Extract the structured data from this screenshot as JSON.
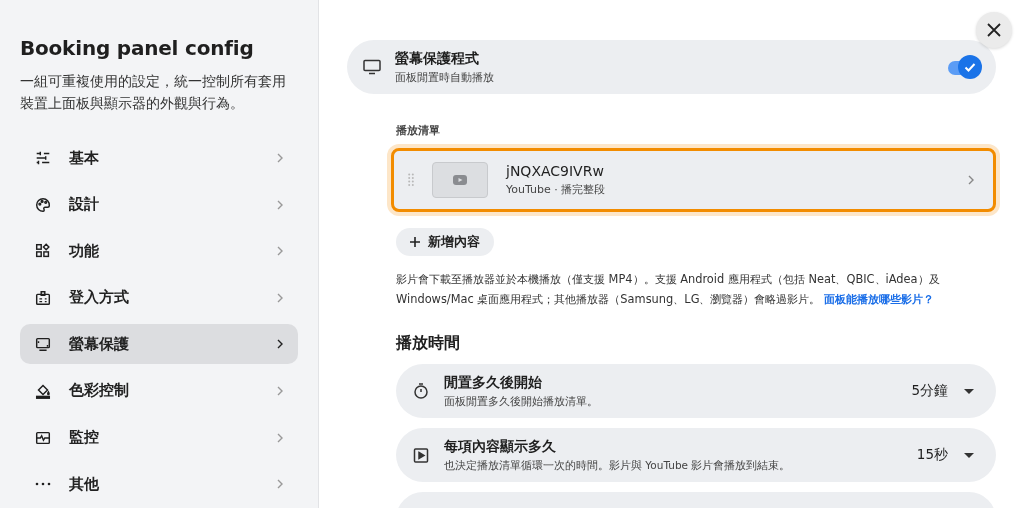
{
  "sidebar": {
    "title": "Booking panel config",
    "description": "一組可重複使用的設定，統一控制所有套用裝置上面板與顯示器的外觀與行為。",
    "items": [
      {
        "label": "基本",
        "selected": false
      },
      {
        "label": "設計",
        "selected": false
      },
      {
        "label": "功能",
        "selected": false
      },
      {
        "label": "登入方式",
        "selected": false
      },
      {
        "label": "螢幕保護",
        "selected": true
      },
      {
        "label": "色彩控制",
        "selected": false
      },
      {
        "label": "監控",
        "selected": false
      },
      {
        "label": "其他",
        "selected": false
      }
    ]
  },
  "screensaver": {
    "title": "螢幕保護程式",
    "subtitle": "面板閒置時自動播放",
    "on": true
  },
  "playlist": {
    "label": "播放清單",
    "items": [
      {
        "title": "jNQXAC9IVRw",
        "subtitle": "YouTube · 播完整段",
        "selected": true
      }
    ],
    "add_button": "新增內容"
  },
  "note": {
    "text": "影片會下載至播放器並於本機播放（僅支援 MP4）。支援 Android 應用程式（包括 Neat、QBIC、iAdea）及 Windows/Mac 桌面應用程式；其他播放器（Samsung、LG、瀏覽器）會略過影片。",
    "link": "面板能播放哪些影片？"
  },
  "playback_time": {
    "heading": "播放時間",
    "rows": [
      {
        "kind": "timer",
        "title": "閒置多久後開始",
        "subtitle": "面板閒置多久後開始播放清單。",
        "value": "5分鐘"
      },
      {
        "kind": "play",
        "title": "每項內容顯示多久",
        "subtitle": "也決定播放清單循環一次的時間。影片與 YouTube 影片會播放到結束。",
        "value": "15秒"
      }
    ]
  }
}
